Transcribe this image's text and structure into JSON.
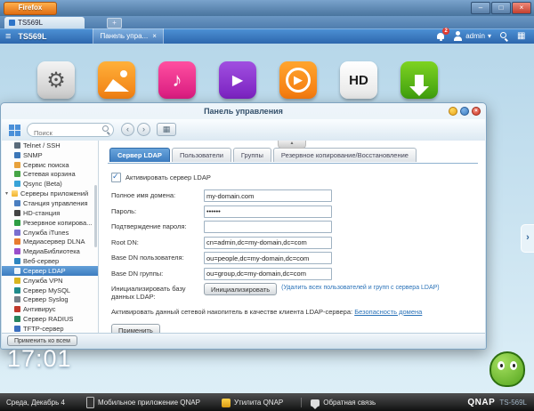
{
  "browser": {
    "app_button": "Firefox",
    "tab_title": "TS569L",
    "new_tab_label": "+",
    "minimize": "–",
    "maximize": "□",
    "close": "×"
  },
  "qnap_bar": {
    "menu_icon": "≡",
    "device_name": "TS569L",
    "open_tab": "Панель упра...",
    "tab_close": "×",
    "notification_count": "2",
    "user_name": "admin",
    "user_caret": "▾"
  },
  "desktop": {
    "clock": "17:01",
    "hd_icon_label": "HD",
    "music_glyph": "♪",
    "video_glyph": "▶",
    "play_glyph": "▶",
    "gear_glyph": "⚙",
    "dock_arrow": "›"
  },
  "taskbar": {
    "date": "Среда, Декабрь 4",
    "mobile_app": "Мобильное приложение QNAP",
    "utility": "Утилита QNAP",
    "feedback": "Обратная связь",
    "brand": "QNAP",
    "model": "TS-569L"
  },
  "panel": {
    "title": "Панель управления",
    "search_placeholder": "Поиск",
    "back": "‹",
    "forward": "›",
    "view_icon": "▦",
    "collapse": "▲",
    "sidebar": {
      "items": [
        {
          "label": "Telnet / SSH"
        },
        {
          "label": "SNMP"
        },
        {
          "label": "Сервис поиска"
        },
        {
          "label": "Сетевая корзина"
        },
        {
          "label": "Qsync (Beta)"
        },
        {
          "label": "Серверы приложений"
        },
        {
          "label": "Станция управления"
        },
        {
          "label": "HD-станция"
        },
        {
          "label": "Резервное копирова..."
        },
        {
          "label": "Служба iTunes"
        },
        {
          "label": "Медиасервер DLNA"
        },
        {
          "label": "МедиаБиблиотека"
        },
        {
          "label": "Веб-сервер"
        },
        {
          "label": "Сервер LDAP"
        },
        {
          "label": "Служба VPN"
        },
        {
          "label": "Сервер MySQL"
        },
        {
          "label": "Сервер Syslog"
        },
        {
          "label": "Антивирус"
        },
        {
          "label": "Сервер RADIUS"
        },
        {
          "label": "TFTP-сервер"
        }
      ]
    },
    "tabs": [
      {
        "label": "Сервер LDAP"
      },
      {
        "label": "Пользователи"
      },
      {
        "label": "Группы"
      },
      {
        "label": "Резервное копирование/Восстановление"
      }
    ],
    "form": {
      "enable_label": "Активировать сервер LDAP",
      "fields": [
        {
          "label": "Полное имя домена:",
          "value": "my-domain.com"
        },
        {
          "label": "Пароль:",
          "value": "••••••"
        },
        {
          "label": "Подтверждение пароля:",
          "value": ""
        },
        {
          "label": "Root DN:",
          "value": "cn=admin,dc=my-domain,dc=com"
        },
        {
          "label": "Base DN пользователя:",
          "value": "ou=people,dc=my-domain,dc=com"
        },
        {
          "label": "Base DN группы:",
          "value": "ou=group,dc=my-domain,dc=com"
        }
      ],
      "init_label": "Инициализировать базу данных LDAP:",
      "init_button": "Инициализировать",
      "init_hint": "(Удалить всех пользователей и групп с сервера LDAP)",
      "client_label": "Активировать данный сетевой накопитель в качестве клиента LDAP-сервера:",
      "client_link": "Безопасность домена",
      "apply_button": "Применить"
    },
    "footer_button": "Применить ко всем"
  }
}
